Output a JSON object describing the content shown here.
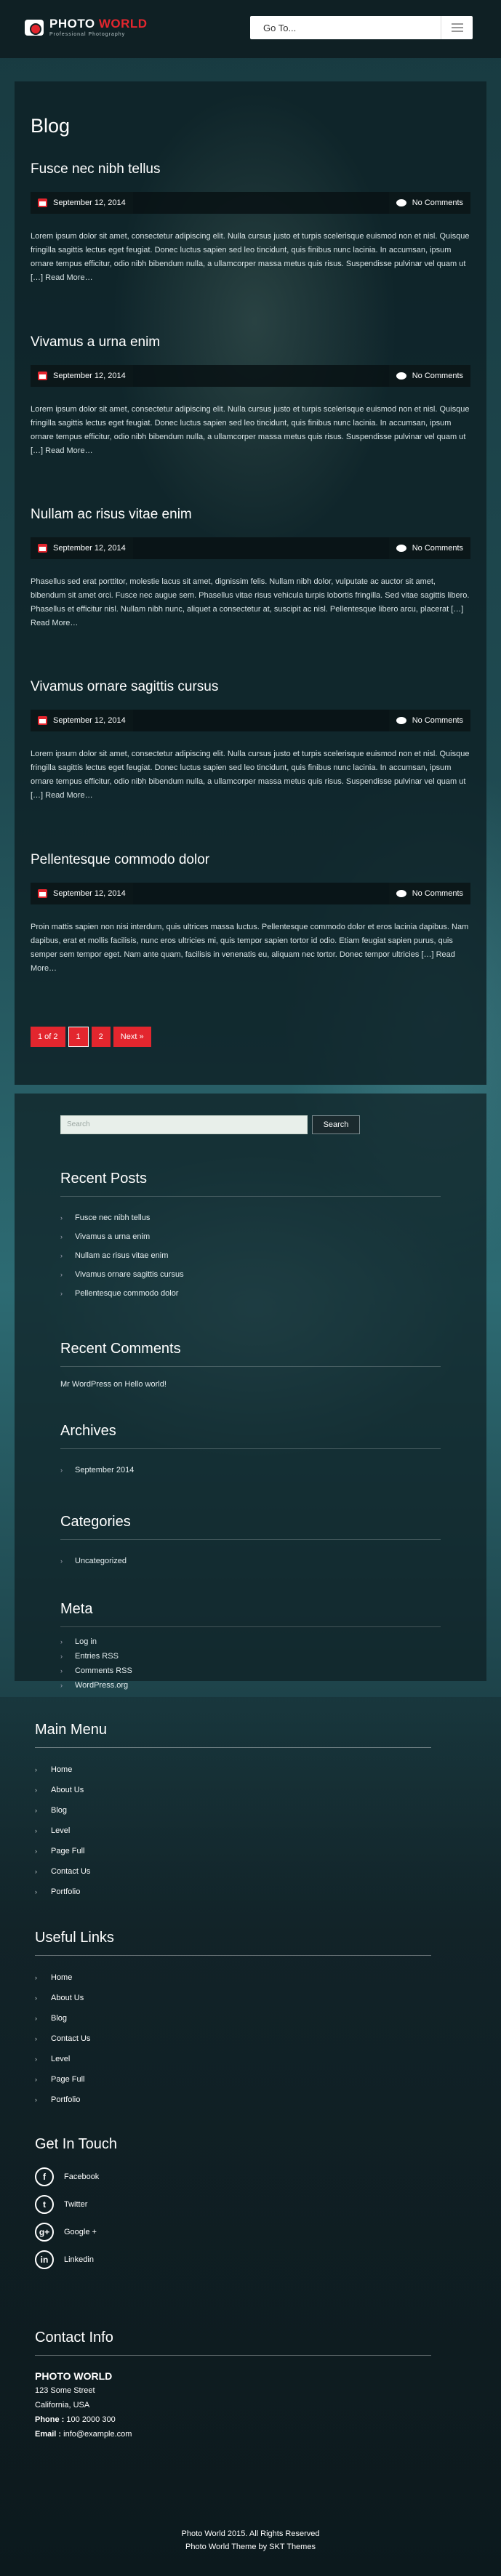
{
  "header": {
    "logo_title_main": "PHOTO",
    "logo_title_accent": "WORLD",
    "logo_subtitle": "Professional Photography",
    "goto_label": "Go To..."
  },
  "blog": {
    "heading": "Blog",
    "posts": [
      {
        "title": "Fusce nec nibh tellus",
        "date": "September 12, 2014",
        "comments": "No Comments",
        "excerpt": "Lorem ipsum dolor sit amet, consectetur adipiscing elit. Nulla cursus justo et turpis scelerisque euismod non et nisl. Quisque fringilla sagittis lectus eget feugiat. Donec luctus sapien sed leo tincidunt, quis finibus nunc lacinia. In accumsan, ipsum ornare tempus efficitur, odio nibh bibendum nulla, a ullamcorper massa metus quis risus. Suspendisse pulvinar vel quam ut",
        "more": "[…] Read More…"
      },
      {
        "title": "Vivamus a urna enim",
        "date": "September 12, 2014",
        "comments": "No Comments",
        "excerpt": "Lorem ipsum dolor sit amet, consectetur adipiscing elit. Nulla cursus justo et turpis scelerisque euismod non et nisl. Quisque fringilla sagittis lectus eget feugiat. Donec luctus sapien sed leo tincidunt, quis finibus nunc lacinia. In accumsan, ipsum ornare tempus efficitur, odio nibh bibendum nulla, a ullamcorper massa metus quis risus. Suspendisse pulvinar vel quam ut",
        "more": "[…] Read More…"
      },
      {
        "title": "Nullam ac risus vitae enim",
        "date": "September 12, 2014",
        "comments": "No Comments",
        "excerpt": "Phasellus sed erat porttitor, molestie lacus sit amet, dignissim felis. Nullam nibh dolor, vulputate ac auctor sit amet, bibendum sit amet orci. Fusce nec augue sem. Phasellus vitae risus vehicula turpis lobortis fringilla. Sed vitae sagittis libero. Phasellus et efficitur nisl. Nullam nibh nunc, aliquet a consectetur at, suscipit ac nisl. Pellentesque libero arcu, placerat",
        "more": "[…] Read More…"
      },
      {
        "title": "Vivamus ornare sagittis cursus",
        "date": "September 12, 2014",
        "comments": "No Comments",
        "excerpt": "Lorem ipsum dolor sit amet, consectetur adipiscing elit. Nulla cursus justo et turpis scelerisque euismod non et nisl. Quisque fringilla sagittis lectus eget feugiat. Donec luctus sapien sed leo tincidunt, quis finibus nunc lacinia. In accumsan, ipsum ornare tempus efficitur, odio nibh bibendum nulla, a ullamcorper massa metus quis risus. Suspendisse pulvinar vel quam ut",
        "more": "[…] Read More…"
      },
      {
        "title": "Pellentesque commodo dolor",
        "date": "September 12, 2014",
        "comments": "No Comments",
        "excerpt": "Proin mattis sapien non nisi interdum, quis ultrices massa luctus. Pellentesque commodo dolor et eros lacinia dapibus. Nam dapibus, erat et mollis facilisis, nunc eros ultricies mi, quis tempor sapien tortor id odio. Etiam feugiat sapien purus, quis semper sem tempor eget. Nam ante quam, facilisis in venenatis eu, aliquam nec tortor. Donec tempor ultricies",
        "more": "[…] Read More…"
      }
    ],
    "pager": {
      "summary": "1 of 2",
      "current": "1",
      "page2": "2",
      "next": "Next »"
    }
  },
  "sidebar": {
    "search_placeholder": "Search",
    "search_button": "Search",
    "recent_posts_title": "Recent Posts",
    "recent_posts": [
      "Fusce nec nibh tellus",
      "Vivamus a urna enim",
      "Nullam ac risus vitae enim",
      "Vivamus ornare sagittis cursus",
      "Pellentesque commodo dolor"
    ],
    "recent_comments_title": "Recent Comments",
    "recent_comment": "Mr WordPress on Hello world!",
    "archives_title": "Archives",
    "archives": [
      "September 2014"
    ],
    "categories_title": "Categories",
    "categories": [
      "Uncategorized"
    ],
    "meta_title": "Meta",
    "meta": [
      "Log in",
      "Entries RSS",
      "Comments RSS",
      "WordPress.org"
    ]
  },
  "footer": {
    "main_menu_title": "Main Menu",
    "main_menu": [
      "Home",
      "About Us",
      "Blog",
      "Level",
      "Page Full",
      "Contact Us",
      "Portfolio"
    ],
    "useful_links_title": "Useful Links",
    "useful_links": [
      "Home",
      "About Us",
      "Blog",
      "Contact Us",
      "Level",
      "Page Full",
      "Portfolio"
    ],
    "get_in_touch_title": "Get In Touch",
    "social": [
      {
        "label": "Facebook",
        "glyph": "f"
      },
      {
        "label": "Twitter",
        "glyph": "t"
      },
      {
        "label": "Google +",
        "glyph": "g+"
      },
      {
        "label": "Linkedin",
        "glyph": "in"
      }
    ],
    "contact_title": "Contact Info",
    "contact_name": "PHOTO WORLD",
    "contact_address1": "123 Some Street",
    "contact_address2": "California, USA",
    "phone_label": "Phone :",
    "phone_value": "100 2000 300",
    "email_label": "Email :",
    "email_value": "info@example.com",
    "copyright_line1": "Photo World 2015. All Rights Reserved",
    "copyright_line2": "Photo World Theme by SKT Themes"
  },
  "colors": {
    "accent": "#e3262e",
    "header_bg": "#0f2024",
    "panel_bg": "#0e2024"
  }
}
